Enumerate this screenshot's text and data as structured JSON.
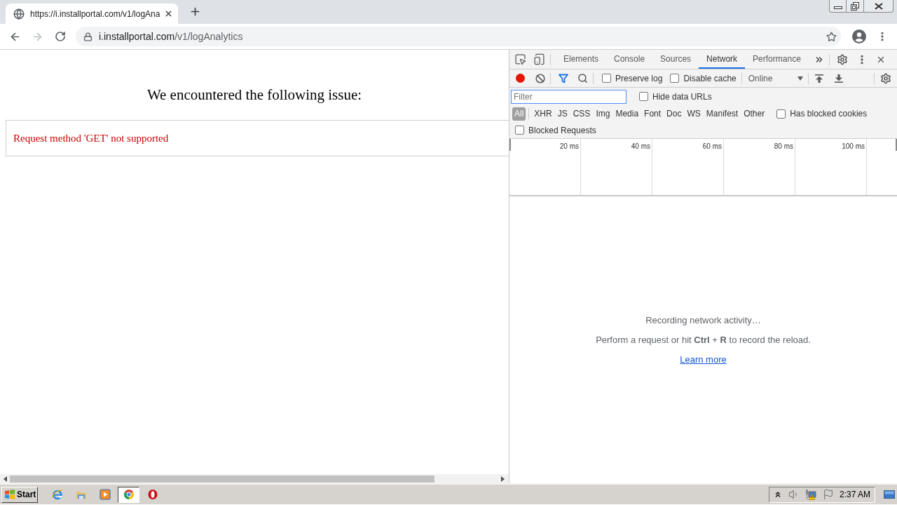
{
  "browser": {
    "tabs": [
      {
        "title": "https://i.installportal.com/v1/logAna",
        "selected": true
      }
    ],
    "toolbar": {
      "back_disabled": false,
      "forward_disabled": true
    },
    "address": {
      "host": "i.installportal.com",
      "path": "/v1/logAnalytics"
    }
  },
  "page": {
    "heading": "We encountered the following issue:",
    "error": "Request method 'GET' not supported"
  },
  "devtools": {
    "tabs": [
      {
        "label": "Elements",
        "selected": false
      },
      {
        "label": "Console",
        "selected": false
      },
      {
        "label": "Sources",
        "selected": false
      },
      {
        "label": "Network",
        "selected": true
      },
      {
        "label": "Performance",
        "selected": false
      }
    ],
    "network": {
      "recording": true,
      "options": [
        {
          "label": "Preserve log",
          "checked": false
        },
        {
          "label": "Disable cache",
          "checked": false
        }
      ],
      "throttling": "Online",
      "filter": {
        "placeholder": "Filter"
      },
      "hide_data_urls": {
        "label": "Hide data URLs",
        "checked": false
      },
      "types": [
        {
          "label": "All",
          "selected": true
        },
        {
          "label": "XHR",
          "selected": false
        },
        {
          "label": "JS",
          "selected": false
        },
        {
          "label": "CSS",
          "selected": false
        },
        {
          "label": "Img",
          "selected": false
        },
        {
          "label": "Media",
          "selected": false
        },
        {
          "label": "Font",
          "selected": false
        },
        {
          "label": "Doc",
          "selected": false
        },
        {
          "label": "WS",
          "selected": false
        },
        {
          "label": "Manifest",
          "selected": false
        },
        {
          "label": "Other",
          "selected": false
        }
      ],
      "has_blocked_cookies": {
        "label": "Has blocked cookies",
        "checked": false
      },
      "blocked_requests": {
        "label": "Blocked Requests",
        "checked": false
      },
      "overview": {
        "ticks": [
          "20 ms",
          "40 ms",
          "60 ms",
          "80 ms",
          "100 ms"
        ]
      },
      "empty_state": {
        "title": "Recording network activity…",
        "hint": "Perform a request or hit **Ctrl** + **R** to record the reload.",
        "link": "Learn more"
      }
    }
  },
  "taskbar": {
    "start": "Start",
    "apps": [
      {
        "kind": "ie",
        "selected": false
      },
      {
        "kind": "explorer",
        "selected": false
      },
      {
        "kind": "media",
        "selected": false
      },
      {
        "kind": "chrome",
        "selected": true
      },
      {
        "kind": "opera",
        "selected": false
      }
    ],
    "clock": "2:37 AM"
  }
}
